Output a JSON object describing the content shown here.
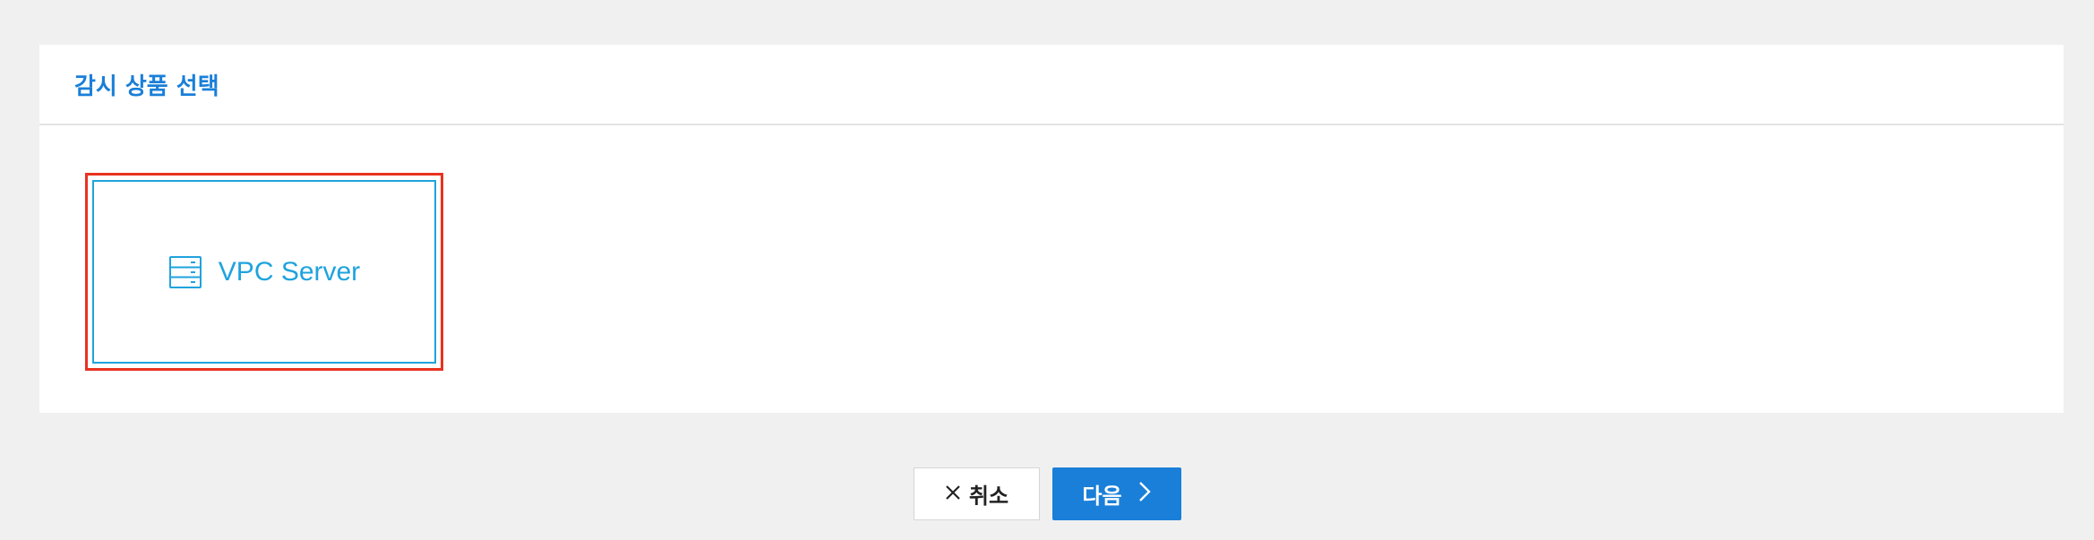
{
  "header": {
    "title": "감시 상품 선택"
  },
  "products": [
    {
      "label": "VPC Server",
      "icon": "server-icon"
    }
  ],
  "footer": {
    "cancel_label": "취소",
    "cancel_icon": "close-icon",
    "next_label": "다음",
    "next_icon": "chevron-right-icon"
  },
  "colors": {
    "accent": "#1a7fd8",
    "card_border": "#1fa3dd",
    "selection_border": "#e8321f",
    "background": "#f0f0f0"
  }
}
